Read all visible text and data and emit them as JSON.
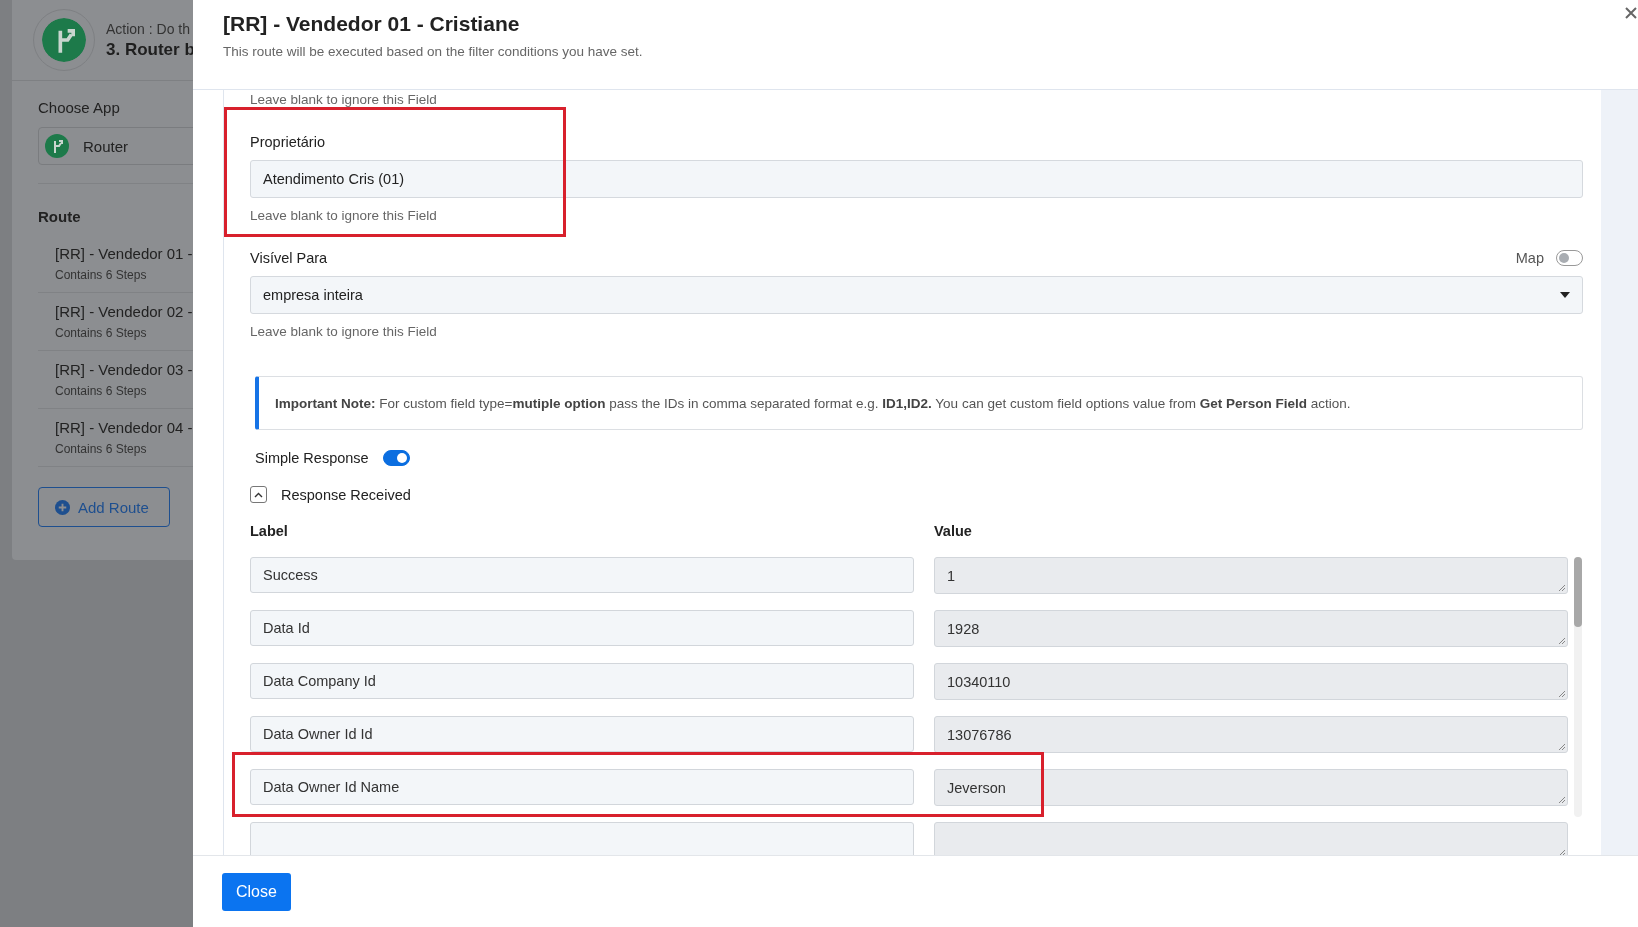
{
  "background": {
    "action_label": "Action : Do th",
    "step_title": "3. Router b",
    "choose_app": {
      "label": "Choose App",
      "value": "Router"
    },
    "route_heading": "Route",
    "routes": [
      {
        "title": "[RR] - Vendedor 01 -",
        "steps": "Contains 6 Steps"
      },
      {
        "title": "[RR] - Vendedor 02 -",
        "steps": "Contains 6 Steps"
      },
      {
        "title": "[RR] - Vendedor 03 -",
        "steps": "Contains 6 Steps"
      },
      {
        "title": "[RR] - Vendedor 04 -",
        "steps": "Contains 6 Steps"
      }
    ],
    "add_route_button": "Add Route"
  },
  "modal": {
    "title": "[RR] - Vendedor 01 - Cristiane",
    "subtitle": "This route will be executed based on the filter conditions you have set.",
    "top_hint": "Leave blank to ignore this Field",
    "fields": [
      {
        "kind": "text",
        "label": "Proprietário",
        "value": "Atendimento Cris (01)",
        "hint": "Leave blank to ignore this Field",
        "highlighted": true
      },
      {
        "kind": "select",
        "label": "Visível Para",
        "value": "empresa inteira",
        "hint": "Leave blank to ignore this Field",
        "highlighted": false,
        "map_label": "Map",
        "map_on": false
      }
    ],
    "note": "**Important Note:** For custom field type=**mutiple option** pass the IDs in comma separated format e.g. **ID1,ID2.** You can get custom field options value from **Get Person Field** action.",
    "simple_response": {
      "label": "Simple Response",
      "on": true
    },
    "response": {
      "title": "Response Received",
      "expanded": true,
      "columns": [
        "Label",
        "Value"
      ],
      "rows": [
        {
          "kind": "full",
          "label": "Success",
          "value": "1",
          "highlighted": false
        },
        {
          "kind": "full",
          "label": "Data Id",
          "value": "1928",
          "highlighted": false
        },
        {
          "kind": "full",
          "label": "Data Company Id",
          "value": "10340110",
          "highlighted": false
        },
        {
          "kind": "full",
          "label": "Data Owner Id Id",
          "value": "13076786",
          "highlighted": false
        },
        {
          "kind": "full",
          "label": "Data Owner Id Name",
          "value": "Jeverson",
          "highlighted": true
        },
        {
          "kind": "cut",
          "highlighted": false
        }
      ]
    },
    "close_button": "Close"
  }
}
